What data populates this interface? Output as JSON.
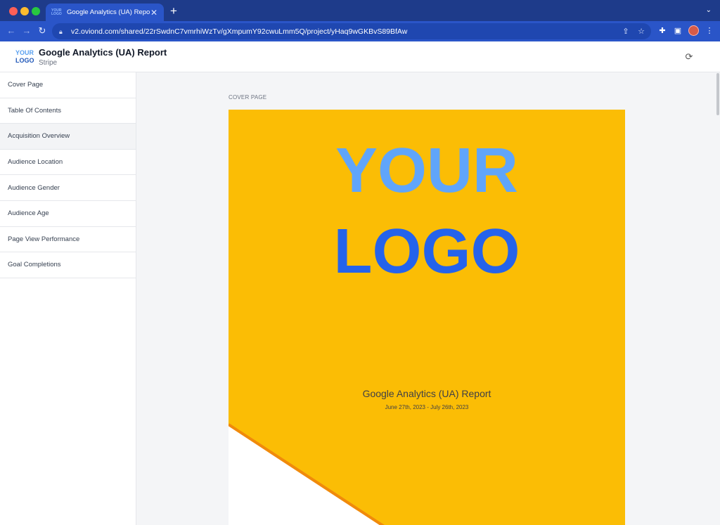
{
  "browser": {
    "tab_title": "Google Analytics (UA) Report",
    "tab_favicon_text": [
      "YOUR",
      "LOGO"
    ],
    "url": "v2.oviond.com/shared/22rSwdnC7vmrhiWzTv/gXmpumY92cwuLmm5Q/project/yHaq9wGKBvS89BfAw",
    "icons": [
      "back-arrow-icon",
      "forward-arrow-icon",
      "reload-icon",
      "lock-icon",
      "share-icon",
      "star-icon",
      "extensions-icon",
      "side-panel-icon",
      "profile-avatar",
      "menu-dots-icon"
    ]
  },
  "header": {
    "logo_line1": "YOUR",
    "logo_line2": "LOGO",
    "title": "Google Analytics (UA) Report",
    "subtitle": "Stripe"
  },
  "sidebar": {
    "items": [
      {
        "label": "Cover Page"
      },
      {
        "label": "Table Of Contents"
      },
      {
        "label": "Acquisition Overview",
        "active": true
      },
      {
        "label": "Audience Location"
      },
      {
        "label": "Audience Gender"
      },
      {
        "label": "Audience Age"
      },
      {
        "label": "Page View Performance"
      },
      {
        "label": "Goal Completions"
      }
    ]
  },
  "main": {
    "section_label": "COVER PAGE",
    "cover": {
      "logo_line1": "YOUR",
      "logo_line2": "LOGO",
      "title": "Google Analytics (UA) Report",
      "date_range": "June 27th, 2023 - July 26th, 2023"
    }
  },
  "colors": {
    "chrome_dark": "#1e3b8a",
    "chrome_tab": "#2a55c8",
    "cover_yellow": "#fbbd05",
    "cover_orange_stripe": "#f08a0b",
    "logo_light_blue": "#60a5fa",
    "logo_dark_blue": "#2563eb"
  }
}
